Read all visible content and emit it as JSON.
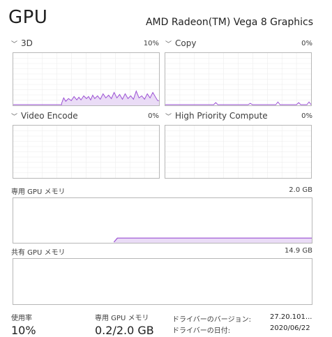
{
  "header": {
    "title": "GPU",
    "adapter": "AMD Radeon(TM) Vega 8 Graphics"
  },
  "engines": [
    {
      "label": "3D",
      "value": "10%",
      "series": [
        0,
        0,
        0,
        0,
        0,
        0,
        0,
        0,
        0,
        0,
        0,
        0,
        0,
        0,
        0,
        0,
        0,
        0,
        0,
        0,
        0,
        0,
        0,
        0,
        0,
        0,
        0,
        0,
        0,
        0,
        0,
        0,
        0,
        0,
        0,
        0,
        0,
        0,
        0,
        0,
        0,
        0,
        0,
        0,
        0,
        0,
        0,
        0,
        0,
        0,
        0,
        0,
        0,
        0,
        0,
        0,
        0,
        0,
        0,
        0,
        0,
        0,
        0,
        0,
        0,
        0,
        0,
        0,
        0,
        0,
        0,
        0,
        0,
        0,
        0,
        0,
        0,
        0,
        0,
        0,
        0,
        0,
        0,
        0,
        0,
        0,
        0,
        0,
        0,
        0,
        0,
        0,
        0,
        0,
        0,
        0,
        0,
        0,
        0,
        0,
        0,
        0,
        0,
        0,
        0,
        0,
        0,
        0,
        0,
        0,
        0,
        0,
        0,
        0,
        0,
        0,
        0,
        0,
        0,
        0,
        0,
        0,
        0,
        0,
        0,
        0,
        0,
        0,
        0,
        0,
        0,
        0,
        0,
        0,
        0,
        0,
        0,
        0,
        0,
        0,
        0,
        0,
        0,
        0,
        0,
        0,
        0,
        0,
        0,
        0,
        0,
        0,
        0,
        0,
        0,
        0,
        0,
        0,
        0,
        0,
        0,
        0,
        0,
        0,
        0,
        0,
        0,
        0,
        0,
        0,
        0,
        0,
        0,
        0,
        0,
        0,
        0,
        0,
        0,
        0,
        0,
        0,
        0,
        0,
        0,
        0,
        0,
        0,
        0,
        0,
        0,
        0,
        0,
        0,
        0,
        0,
        0,
        0,
        0,
        0,
        0,
        0,
        0,
        0,
        0,
        0,
        0,
        0,
        0,
        0,
        0,
        0
      ]
    },
    {
      "label": "Copy",
      "value": "0%",
      "series": [
        0,
        0,
        0,
        0,
        0,
        0,
        0,
        0,
        0,
        0,
        0,
        0,
        0,
        0,
        0,
        0,
        0,
        0,
        0,
        0,
        0,
        0,
        0,
        0,
        0,
        0,
        0,
        0,
        0,
        0,
        0,
        0,
        0,
        0,
        0,
        0,
        0,
        0,
        0,
        0,
        0,
        0,
        0,
        0,
        0,
        0,
        0,
        0,
        0,
        0,
        0,
        0,
        0,
        0,
        0,
        0,
        0,
        0,
        0,
        0,
        0
      ]
    },
    {
      "label": "Video Encode",
      "value": "0%",
      "series": []
    },
    {
      "label": "High Priority Compute",
      "value": "0%",
      "series": []
    }
  ],
  "memory": {
    "dedicated": {
      "label": "専用 GPU メモリ",
      "value": "2.0 GB"
    },
    "shared": {
      "label": "共有 GPU メモリ",
      "value": "14.9 GB"
    }
  },
  "footer": {
    "usage_label": "使用率",
    "usage_value": "10%",
    "dedicated_label": "専用 GPU メモリ",
    "dedicated_value": "0.2/2.0 GB",
    "driver_version_label": "ドライバーのバージョン:",
    "driver_version_value": "27.20.101...",
    "driver_date_label": "ドライバーの日付:",
    "driver_date_value": "2020/06/22"
  },
  "colors": {
    "accent": "#9a4fd3",
    "fill": "#eadcf6",
    "grid": "#ececec",
    "border": "#b7b7b7"
  }
}
